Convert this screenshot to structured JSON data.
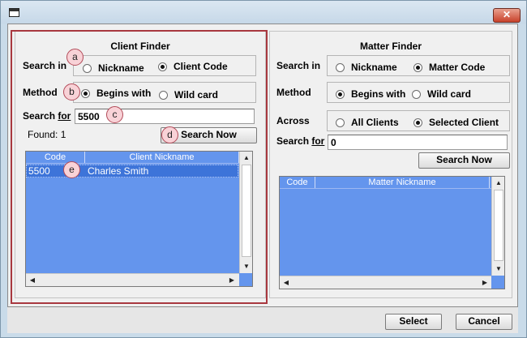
{
  "window": {
    "close_glyph": "✕",
    "app_icon": "window-icon"
  },
  "client_finder": {
    "title": "Client Finder",
    "search_in_label": "Search in",
    "search_in_options": [
      {
        "label": "Nickname",
        "selected": false
      },
      {
        "label": "Client Code",
        "selected": true
      }
    ],
    "method_label": "Method",
    "method_options": [
      {
        "label": "Begins with",
        "selected": true
      },
      {
        "label": "Wild card",
        "selected": false
      }
    ],
    "search_for_label_prefix": "Search ",
    "search_for_label_underlined": "for",
    "search_value": "5500",
    "found_text": "Found: 1",
    "search_now_label": "Search Now",
    "columns": [
      "Code",
      "Client Nickname"
    ],
    "rows": [
      [
        "5500",
        "Charles Smith"
      ]
    ],
    "callouts": [
      "a",
      "b",
      "c",
      "d",
      "e"
    ]
  },
  "matter_finder": {
    "title": "Matter Finder",
    "search_in_label": "Search in",
    "search_in_options": [
      {
        "label": "Nickname",
        "selected": false
      },
      {
        "label": "Matter Code",
        "selected": true
      }
    ],
    "method_label": "Method",
    "method_options": [
      {
        "label": "Begins with",
        "selected": true
      },
      {
        "label": "Wild card",
        "selected": false
      }
    ],
    "across_label": "Across",
    "across_options": [
      {
        "label": "All Clients",
        "selected": false
      },
      {
        "label": "Selected Client",
        "selected": true
      }
    ],
    "search_for_label_prefix": "Search ",
    "search_for_label_underlined": "for",
    "search_value": "0",
    "search_now_label": "Search Now",
    "columns": [
      "Code",
      "Matter Nickname"
    ],
    "rows": []
  },
  "footer": {
    "select_label": "Select",
    "cancel_label": "Cancel"
  },
  "scroll": {
    "up": "▲",
    "down": "▼",
    "left": "◀",
    "right": "▶"
  },
  "colors": {
    "grid_bg": "#6495ed",
    "selected_row": "#3d74d9",
    "callout_border": "#b24a58",
    "frame": "#a8383f"
  }
}
